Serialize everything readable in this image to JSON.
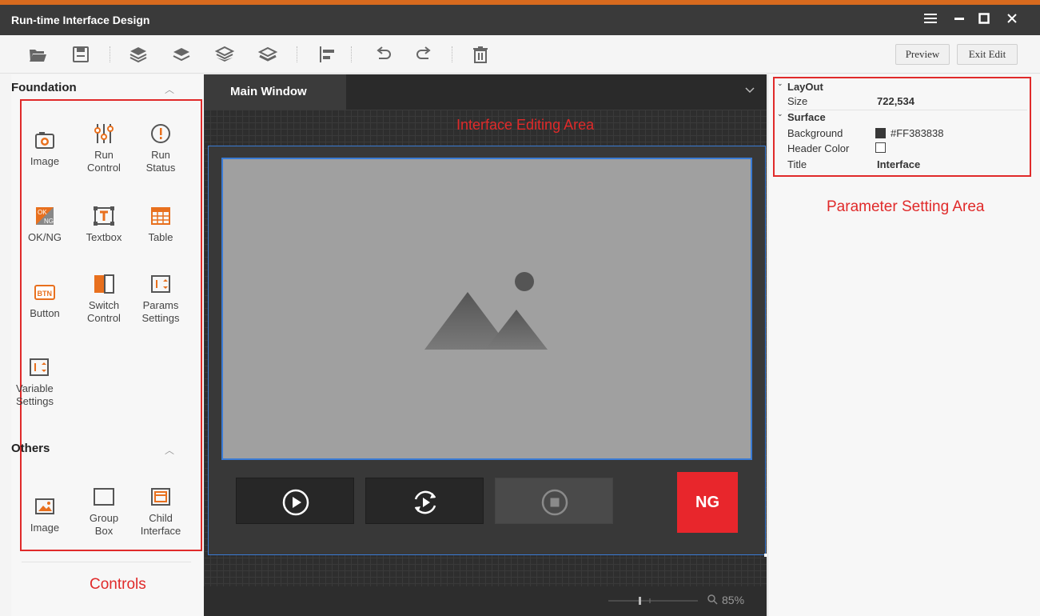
{
  "window": {
    "title": "Run-time Interface Design",
    "accent": "#d76a1e",
    "controls": {
      "menu": "menu-icon",
      "minimize": "minimize-icon",
      "maximize": "maximize-icon",
      "close": "close-icon"
    }
  },
  "toolbar": {
    "icons": [
      "open-folder-icon",
      "save-icon",
      "bring-to-front-icon",
      "bring-forward-icon",
      "send-backward-icon",
      "send-to-back-icon",
      "align-icon",
      "undo-icon",
      "redo-icon",
      "delete-icon"
    ],
    "preview_label": "Preview",
    "exit_edit_label": "Exit Edit"
  },
  "controls_panel": {
    "foundation": {
      "title": "Foundation",
      "items": [
        {
          "label": "Image",
          "icon": "camera-icon"
        },
        {
          "label": "Run\nControl",
          "icon": "run-control-icon"
        },
        {
          "label": "Run\nStatus",
          "icon": "run-status-icon"
        },
        {
          "label": "OK/NG",
          "icon": "ok-ng-icon"
        },
        {
          "label": "Textbox",
          "icon": "textbox-icon"
        },
        {
          "label": "Table",
          "icon": "table-icon"
        },
        {
          "label": "Button",
          "icon": "button-icon"
        },
        {
          "label": "Switch\nControl",
          "icon": "switch-icon"
        },
        {
          "label": "Params\nSettings",
          "icon": "params-icon"
        },
        {
          "label": "Variable\nSettings",
          "icon": "variable-icon"
        }
      ]
    },
    "others": {
      "title": "Others",
      "items": [
        {
          "label": "Image",
          "icon": "picture-icon"
        },
        {
          "label": "Group\nBox",
          "icon": "group-box-icon"
        },
        {
          "label": "Child\nInterface",
          "icon": "child-interface-icon"
        }
      ]
    },
    "annotation": "Controls"
  },
  "editor": {
    "tab_label": "Main Window",
    "annotation": "Interface Editing Area",
    "ng_label": "NG",
    "ng_color": "#e8262c",
    "selection_color": "#3a7bd5",
    "zoom_value": "85%",
    "run_buttons": [
      "play-icon",
      "loop-run-icon",
      "stop-icon"
    ]
  },
  "params_panel": {
    "annotation": "Parameter Setting Area",
    "layout_title": "LayOut",
    "size_label": "Size",
    "size_value": "722,534",
    "surface_title": "Surface",
    "background_label": "Background",
    "background_value": "#FF383838",
    "header_color_label": "Header Color",
    "title_label": "Title",
    "title_value": "Interface"
  }
}
